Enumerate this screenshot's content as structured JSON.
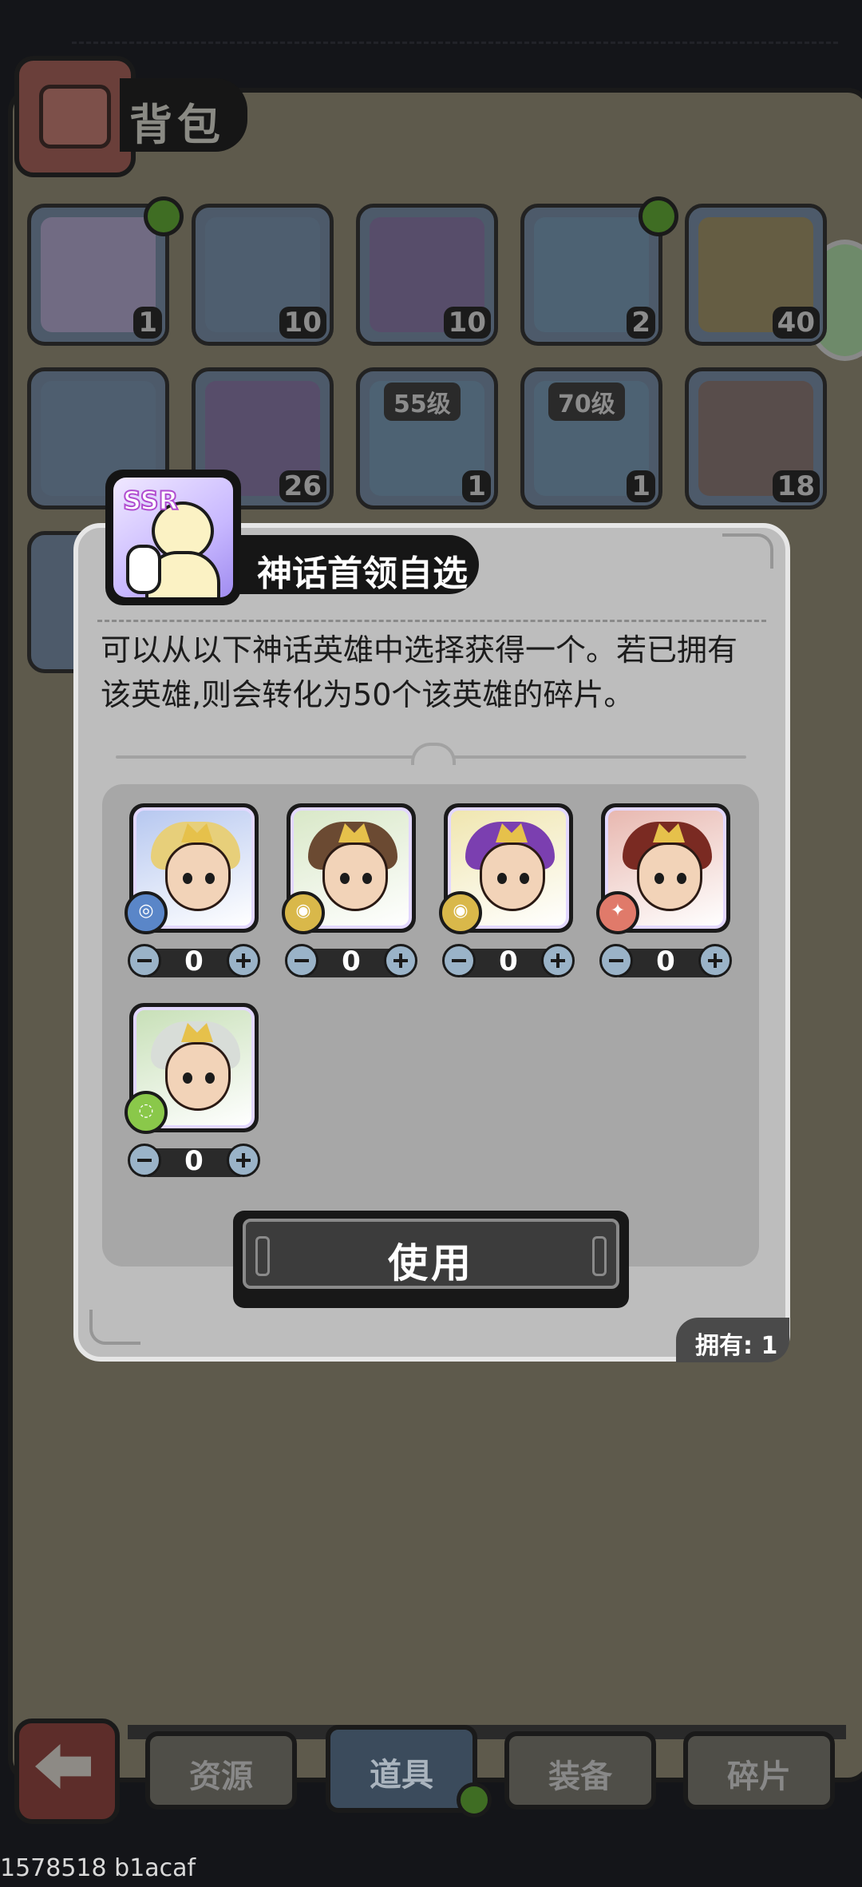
{
  "bag": {
    "title": "背包",
    "slots": [
      {
        "count": "1",
        "color": "#7a6f8a"
      },
      {
        "count": "10",
        "color": "#4f5f70"
      },
      {
        "count": "10",
        "color": "#5a4a6a"
      },
      {
        "count": "2",
        "color": "#4e6476"
      },
      {
        "count": "40",
        "color": "#6c5e3a"
      },
      {
        "count": "",
        "color": "#4f5f70"
      },
      {
        "count": "26",
        "color": "#5a4a6a"
      },
      {
        "count": "1",
        "level": "55级",
        "color": "#4e6476"
      },
      {
        "count": "1",
        "level": "70级",
        "color": "#4e6476"
      },
      {
        "count": "18",
        "color": "#5b4a44"
      }
    ]
  },
  "tabs": {
    "back": "back",
    "resources": "资源",
    "items": "道具",
    "equipment": "装备",
    "fragments": "碎片",
    "active": "items"
  },
  "modal": {
    "title": "神话首领自选",
    "item_badge": "SSR",
    "description": "可以从以下神话英雄中选择获得一个。若已拥有该英雄,则会转化为50个该英雄的碎片。",
    "heroes": [
      {
        "name": "hero-1",
        "element": "water",
        "element_color": "#5a86c8",
        "hair_color": "#e7cf7a",
        "bg": "#b7c8f0",
        "qty": "0"
      },
      {
        "name": "hero-2",
        "element": "earth",
        "element_color": "#d9b84a",
        "hair_color": "#6b4a32",
        "bg": "#d9e8c8",
        "qty": "0"
      },
      {
        "name": "hero-3",
        "element": "earth",
        "element_color": "#d9b84a",
        "hair_color": "#7b3fb0",
        "bg": "#f0e6b0",
        "qty": "0"
      },
      {
        "name": "hero-4",
        "element": "fire",
        "element_color": "#e07a6a",
        "hair_color": "#7a2a22",
        "bg": "#e8b8b0",
        "qty": "0"
      },
      {
        "name": "hero-5",
        "element": "wind",
        "element_color": "#8ac84a",
        "hair_color": "#d8ddd8",
        "bg": "#c8e0b8",
        "qty": "0"
      }
    ],
    "use_label": "使用",
    "owned_label": "拥有: 1"
  },
  "footer": {
    "id_text": "1578518 b1acaf"
  }
}
